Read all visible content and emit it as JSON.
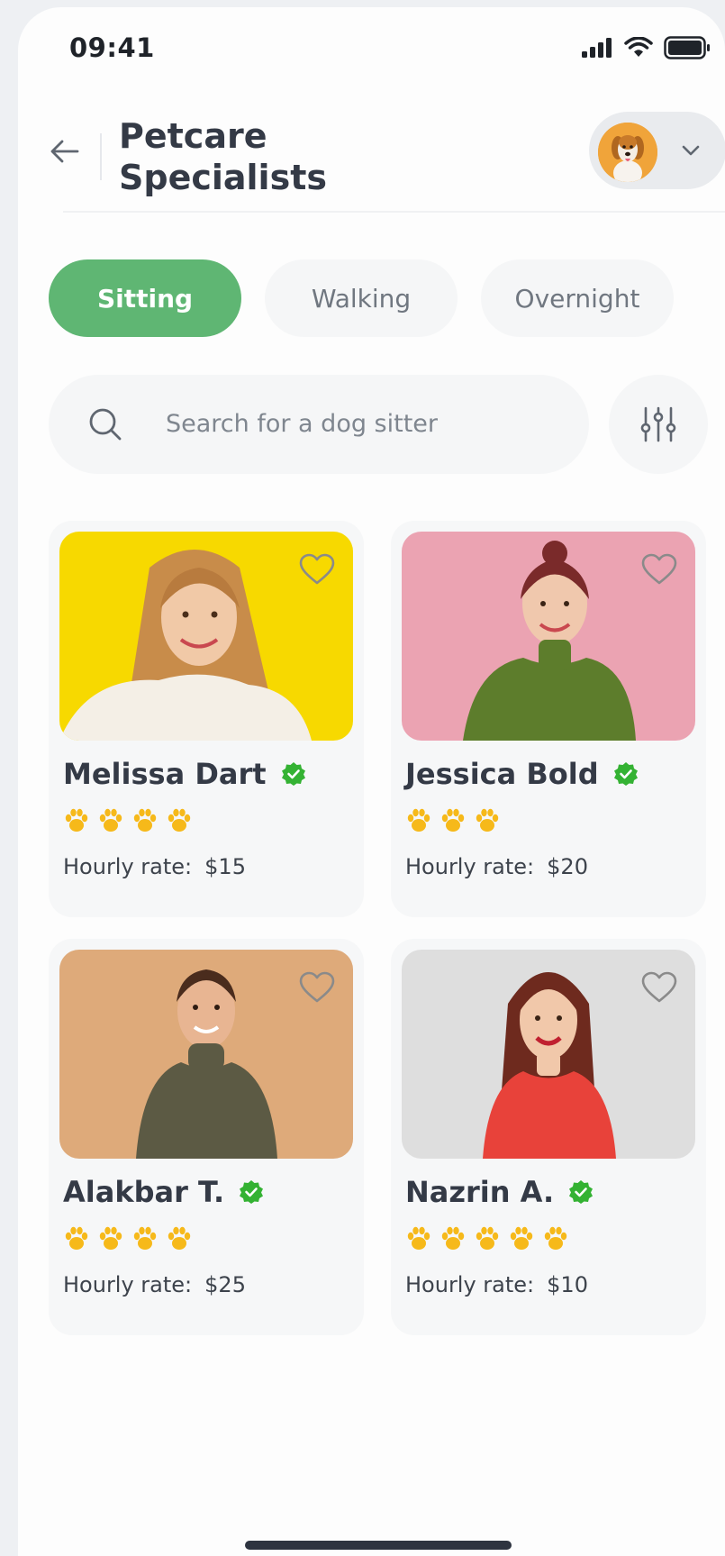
{
  "status_bar": {
    "time": "09:41"
  },
  "header": {
    "title_line1": "Petcare",
    "title_line2": "Specialists"
  },
  "tabs": [
    {
      "label": "Sitting",
      "active": true
    },
    {
      "label": "Walking",
      "active": false
    },
    {
      "label": "Overnight",
      "active": false
    }
  ],
  "search": {
    "placeholder": "Search for a dog sitter"
  },
  "sitters": [
    {
      "name": "Melissa Dart",
      "paws": 4,
      "rate_label": "Hourly rate:",
      "rate": "$15",
      "photo_bg": "#f7d900",
      "verified": true
    },
    {
      "name": "Jessica Bold",
      "paws": 3,
      "rate_label": "Hourly rate:",
      "rate": "$20",
      "photo_bg": "#eba3b2",
      "verified": true
    },
    {
      "name": "Alakbar T.",
      "paws": 4,
      "rate_label": "Hourly rate:",
      "rate": "$25",
      "photo_bg": "#deaa7a",
      "verified": true
    },
    {
      "name": "Nazrin A.",
      "paws": 5,
      "rate_label": "Hourly rate:",
      "rate": "$10",
      "photo_bg": "#dedede",
      "verified": true
    }
  ],
  "colors": {
    "accent": "#5fb673",
    "verified": "#34b233",
    "paw": "#f6b91a"
  },
  "icons": [
    "back-arrow-icon",
    "chevron-down-icon",
    "search-icon",
    "filter-sliders-icon",
    "heart-icon",
    "verified-badge-icon",
    "paw-icon"
  ]
}
